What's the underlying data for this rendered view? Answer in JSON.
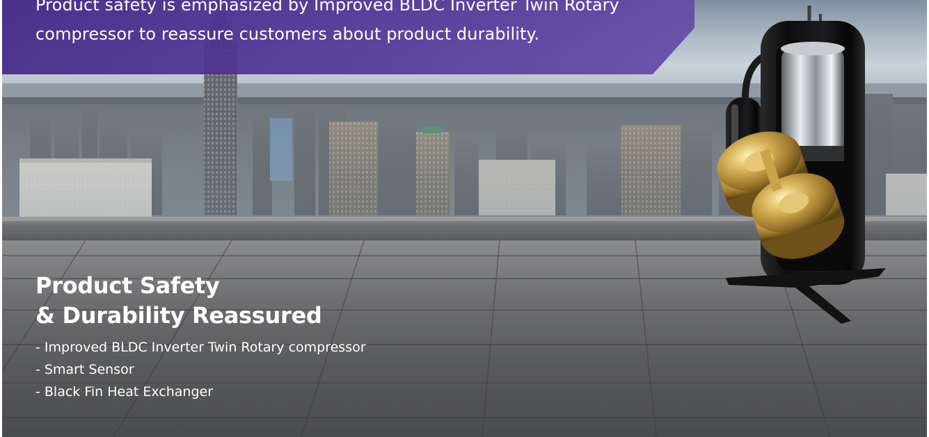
{
  "banner": {
    "text": "Product safety is emphasized by Improved BLDC Inverter Twin Rotary compressor to reassure customers about product durability."
  },
  "headline": {
    "line1": "Product Safety",
    "line2": "& Durability Reassured"
  },
  "features": [
    "- Improved BLDC Inverter Twin Rotary compressor",
    "- Smart Sensor",
    "- Black Fin Heat Exchanger"
  ],
  "colors": {
    "banner": "#4b2d8c",
    "text": "#ffffff",
    "floor": "#5c5d5f"
  },
  "icons": {
    "compressor": "twin-rotary-compressor-image"
  }
}
